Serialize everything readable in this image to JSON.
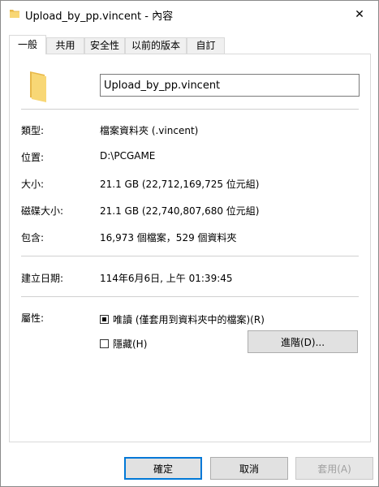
{
  "window": {
    "title": "Upload_by_pp.vincent - 內容",
    "close_glyph": "✕"
  },
  "tabs": [
    {
      "label": "一般",
      "active": true
    },
    {
      "label": "共用",
      "active": false
    },
    {
      "label": "安全性",
      "active": false
    },
    {
      "label": "以前的版本",
      "active": false
    },
    {
      "label": "自訂",
      "active": false
    }
  ],
  "general": {
    "name_value": "Upload_by_pp.vincent",
    "type": {
      "label": "類型:",
      "value": "檔案資料夾 (.vincent)"
    },
    "location": {
      "label": "位置:",
      "value": "D:\\PCGAME"
    },
    "size": {
      "label": "大小:",
      "value": "21.1 GB (22,712,169,725 位元組)"
    },
    "size_on_disk": {
      "label": "磁碟大小:",
      "value": "21.1 GB (22,740,807,680 位元組)"
    },
    "contains": {
      "label": "包含:",
      "value": "16,973 個檔案，529 個資料夾"
    },
    "created": {
      "label": "建立日期:",
      "value": "114年6月6日, 上午 01:39:45"
    },
    "attributes": {
      "label": "屬性:",
      "readonly_label": "唯讀 (僅套用到資料夾中的檔案)(R)",
      "readonly_state": "indeterminate",
      "hidden_label": "隱藏(H)",
      "hidden_state": "unchecked",
      "advanced_label": "進階(D)..."
    }
  },
  "footer": {
    "ok_label": "確定",
    "cancel_label": "取消",
    "apply_label": "套用(A)"
  },
  "icons": {
    "title": "folder-icon",
    "big": "folder-icon",
    "close": "close-icon"
  },
  "colors": {
    "folder": "#f8d775",
    "folder_dark": "#e8b84a",
    "focus_border": "#0078d7"
  }
}
